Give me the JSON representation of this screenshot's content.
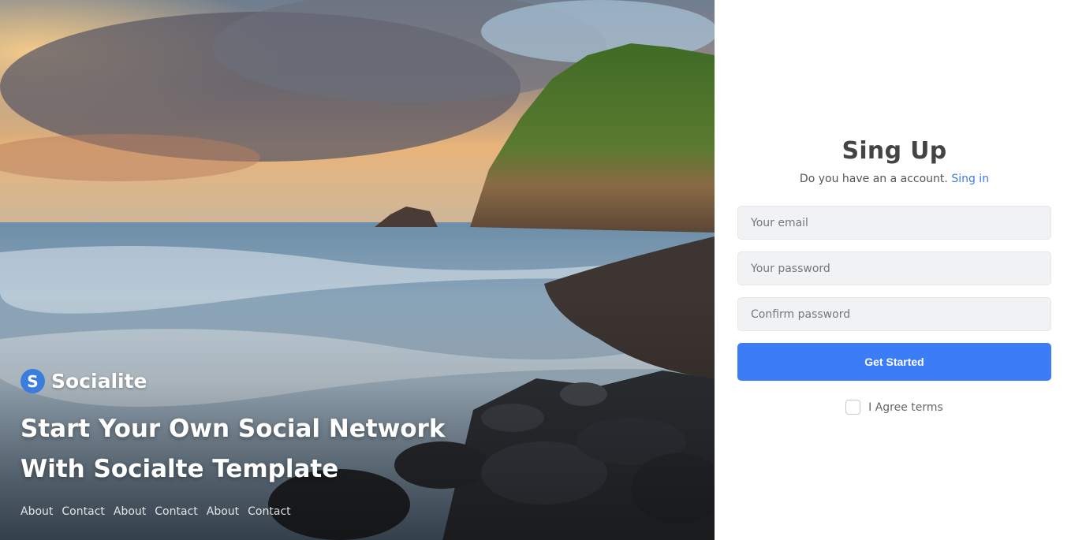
{
  "brand": {
    "logo_letter": "S",
    "name": "Socialite"
  },
  "hero": {
    "headline_line1": "Start Your Own Social Network",
    "headline_line2": "With Socialte Template",
    "links": [
      "About",
      "Contact",
      "About",
      "Contact",
      "About",
      "Contact"
    ]
  },
  "form": {
    "title": "Sing Up",
    "subtitle": "Do you have an a account.",
    "signin_link": "Sing in",
    "email_placeholder": "Your email",
    "password_placeholder": "Your password",
    "confirm_placeholder": "Confirm password",
    "submit_label": "Get Started",
    "terms_label": "I Agree terms",
    "terms_checked": false
  },
  "colors": {
    "accent": "#3c7df7",
    "link": "#3b7ddd",
    "field_bg": "#f1f2f4"
  }
}
